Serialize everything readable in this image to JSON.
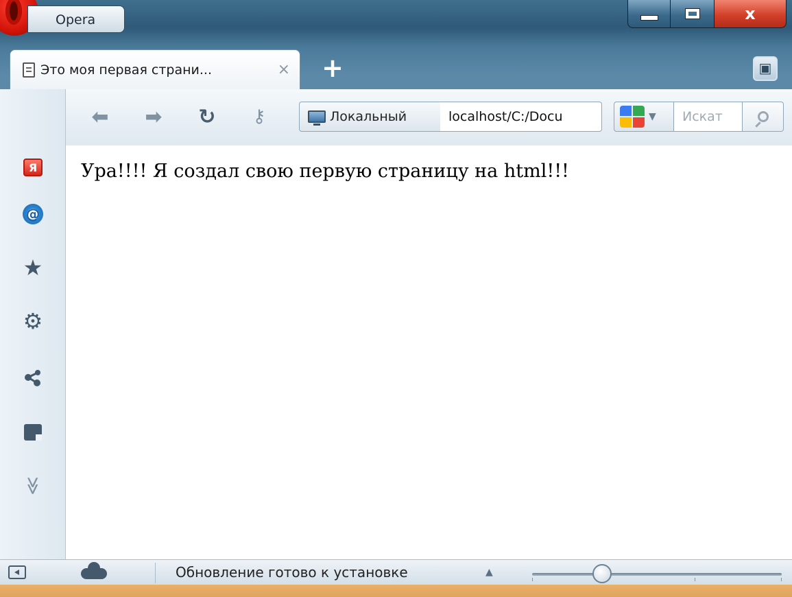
{
  "window": {
    "app_button_label": "Opera",
    "controls": {
      "minimize": "minimize",
      "maximize": "maximize",
      "close": "x"
    }
  },
  "tabs": [
    {
      "title": "Это моя первая страни...",
      "close_glyph": "×"
    }
  ],
  "toolbar": {
    "site_label": "Локальный",
    "address": "localhost/C:/Docu",
    "search_placeholder": "Искат"
  },
  "sidebar": {
    "items": [
      {
        "icon": "yandex-icon",
        "glyph": "Я"
      },
      {
        "icon": "mail-icon",
        "glyph": "@"
      },
      {
        "icon": "bookmarks-icon",
        "glyph": "★"
      },
      {
        "icon": "settings-icon",
        "glyph": "⚙"
      },
      {
        "icon": "unite-icon",
        "glyph": ""
      },
      {
        "icon": "notes-icon",
        "glyph": ""
      },
      {
        "icon": "more-icon",
        "glyph": "≫"
      }
    ]
  },
  "content": {
    "text": "Ура!!!! Я создал свою первую страницу на html!!!"
  },
  "status": {
    "update_text": "Обновление готово к установке",
    "zoom_fraction": 0.28
  },
  "colors": {
    "frame_blue": "#3f6f8e",
    "close_red": "#d2402a",
    "icon_gray": "#44596b"
  }
}
